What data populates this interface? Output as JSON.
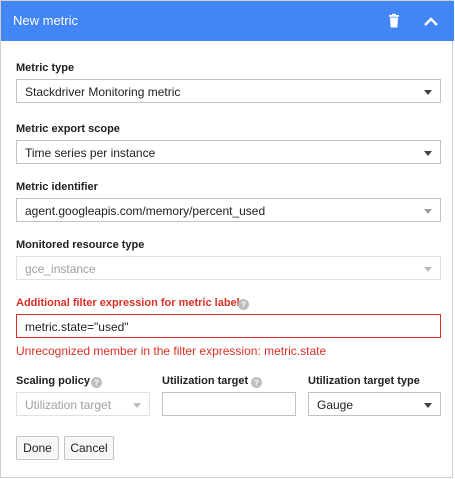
{
  "header": {
    "title": "New metric",
    "trash_icon": "trash-icon",
    "collapse_icon": "chevron-up-icon",
    "color": "#4285f4"
  },
  "fields": {
    "metric_type": {
      "label": "Metric type",
      "value": "Stackdriver Monitoring metric"
    },
    "export_scope": {
      "label": "Metric export scope",
      "value": "Time series per instance"
    },
    "metric_identifier": {
      "label": "Metric identifier",
      "value": "agent.googleapis.com/memory/percent_used"
    },
    "monitored_resource": {
      "label": "Monitored resource type",
      "value": "gce_instance",
      "disabled": true
    },
    "filter": {
      "label": "Additional filter expression for metric labels",
      "value": "metric.state=\"used\"",
      "error": "Unrecognized member in the filter expression: metric.state",
      "error_color": "#d93025"
    }
  },
  "scaling": {
    "policy": {
      "label": "Scaling policy",
      "value": "Utilization target",
      "disabled": true
    },
    "target": {
      "label": "Utilization target",
      "value": ""
    },
    "target_type": {
      "label": "Utilization target type",
      "value": "Gauge"
    }
  },
  "actions": {
    "done": "Done",
    "cancel": "Cancel"
  }
}
